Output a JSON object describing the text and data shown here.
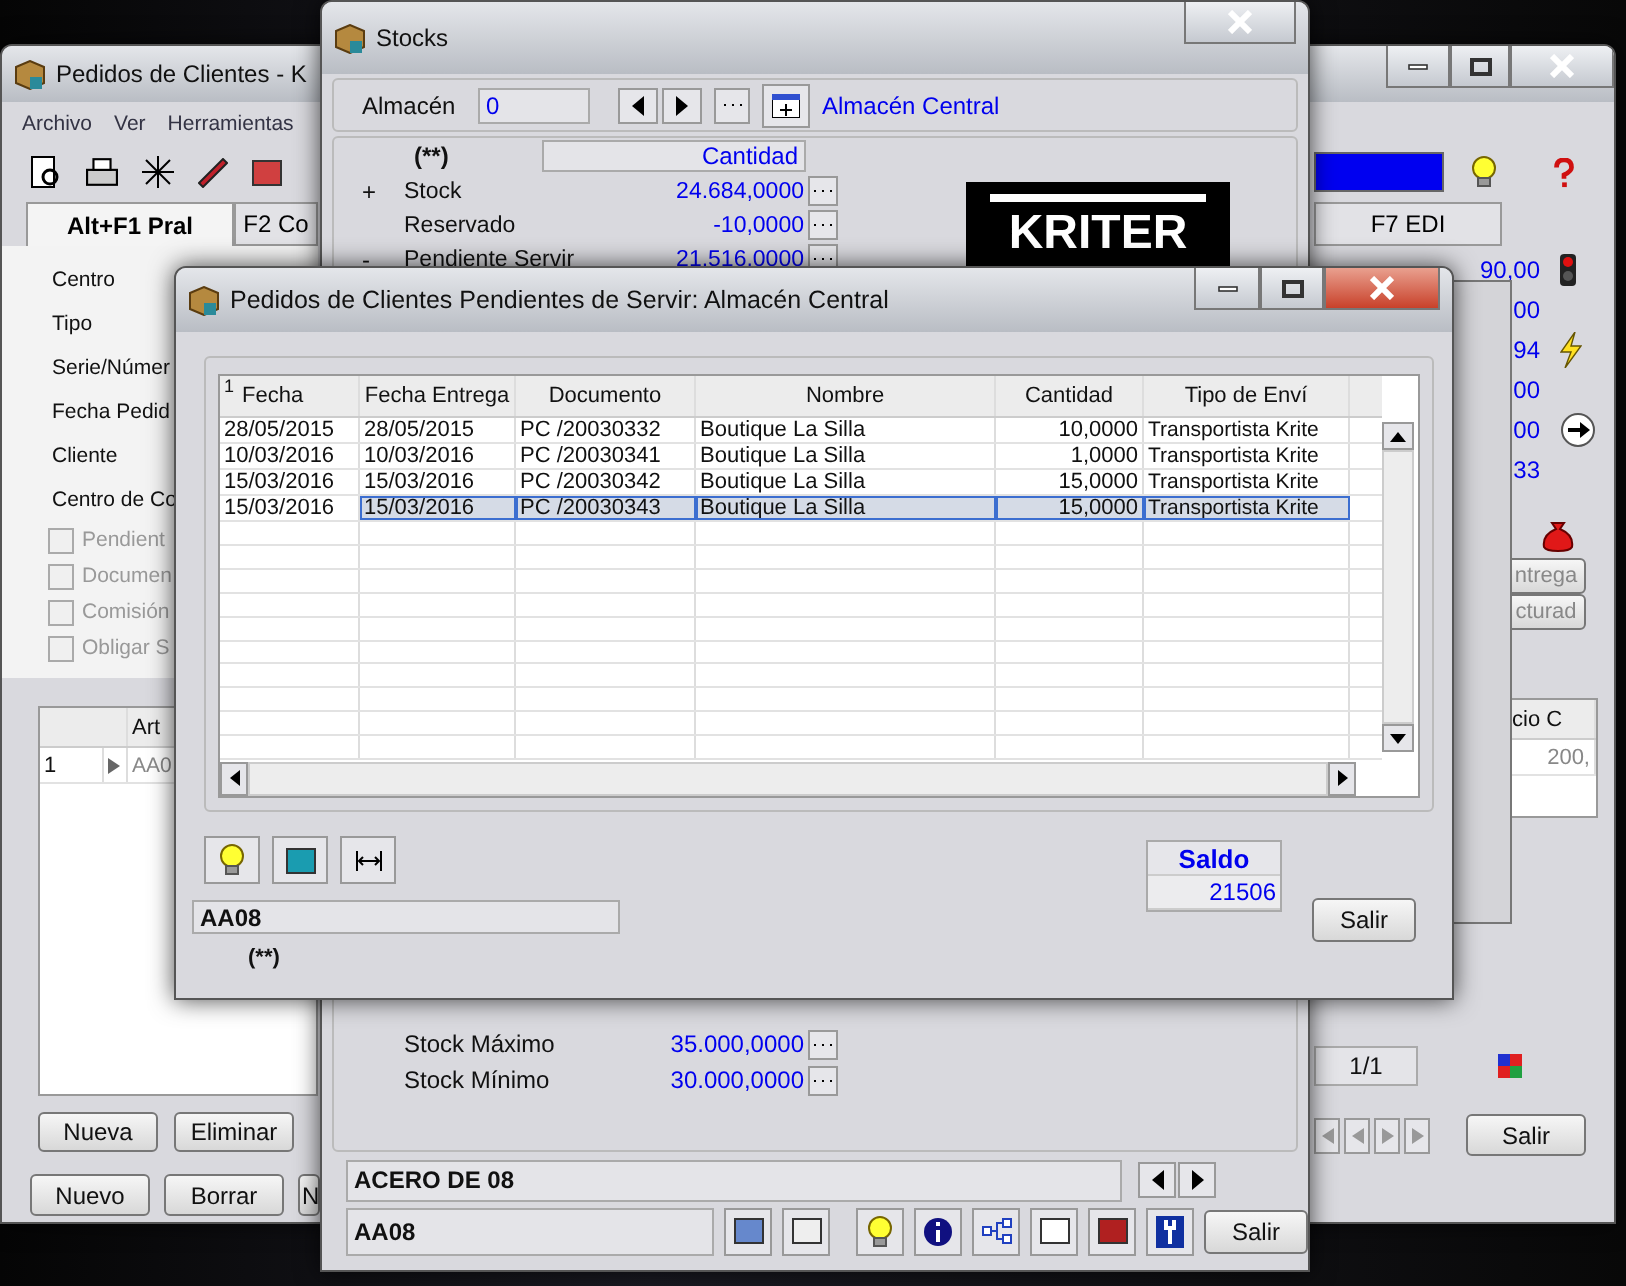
{
  "main_window": {
    "title": "Pedidos de Clientes - K",
    "menu": [
      "Archivo",
      "Ver",
      "Herramientas"
    ],
    "tabs": [
      {
        "label": "Alt+F1 Pral",
        "selected": true
      },
      {
        "label": "F2 Co",
        "selected": false
      },
      {
        "label": "F7 EDI",
        "selected": false
      }
    ],
    "fields": [
      "Centro",
      "Tipo",
      "Serie/Númer",
      "Fecha Pedid",
      "Cliente",
      "Centro de Co"
    ],
    "checkboxes": [
      {
        "label": "Pendient",
        "checked": false
      },
      {
        "label": "Documen",
        "checked": false
      },
      {
        "label": "Comisión",
        "checked": false
      },
      {
        "label": "Obligar S",
        "checked": false
      }
    ],
    "values": [
      "90,00",
      "00",
      "94",
      "00",
      "00",
      "33"
    ],
    "side_buttons": [
      "ntrega",
      "cturad"
    ],
    "lines": {
      "columns": [
        "Art",
        "cio C"
      ],
      "rows": [
        {
          "number": "1",
          "article": "AA0",
          "price": "200,"
        }
      ]
    },
    "line_buttons": [
      "Nueva",
      "Eliminar"
    ],
    "buttons": [
      "Nuevo",
      "Borrar",
      "N"
    ],
    "page": "1/1",
    "exit": "Salir"
  },
  "stocks_window": {
    "title": "Stocks",
    "warehouse_label": "Almacén",
    "warehouse_code": "0",
    "warehouse_name": "Almacén Central",
    "marker": "(**)",
    "column": "Cantidad",
    "logo_text": "KRITER",
    "rows": [
      {
        "sign": "+",
        "label": "Stock",
        "value": "24.684,0000"
      },
      {
        "label": "Reservado",
        "value": "-10,0000"
      },
      {
        "sign": "-",
        "label": "Pendiente Servir",
        "value": "21.516,0000"
      }
    ],
    "limits": [
      {
        "label": "Stock Máximo",
        "value": "35.000,0000"
      },
      {
        "label": "Stock Mínimo",
        "value": "30.000,0000"
      }
    ],
    "description": "ACERO DE 08",
    "code": "AA08",
    "exit": "Salir"
  },
  "pending_dialog": {
    "title": "Pedidos de Clientes Pendientes de Servir: Almacén Central",
    "sort_index": "1",
    "columns": [
      "Fecha",
      "Fecha Entrega",
      "Documento",
      "Nombre",
      "Cantidad",
      "Tipo de Enví"
    ],
    "rows": [
      {
        "cells": [
          "28/05/2015",
          "28/05/2015",
          "PC /20030332",
          "Boutique La Silla",
          "10,0000",
          "Transportista Krite"
        ],
        "selected": false
      },
      {
        "cells": [
          "10/03/2016",
          "10/03/2016",
          "PC /20030341",
          "Boutique La Silla",
          "1,0000",
          "Transportista Krite"
        ],
        "selected": false
      },
      {
        "cells": [
          "15/03/2016",
          "15/03/2016",
          "PC /20030342",
          "Boutique La Silla",
          "15,0000",
          "Transportista Krite"
        ],
        "selected": false
      },
      {
        "cells": [
          "15/03/2016",
          "15/03/2016",
          "PC /20030343",
          "Boutique La Silla",
          "15,0000",
          "Transportista Krite"
        ],
        "selected": true
      }
    ],
    "code": "AA08",
    "marker": "(**)",
    "balance_label": "Saldo",
    "balance": "21506",
    "exit": "Salir"
  }
}
